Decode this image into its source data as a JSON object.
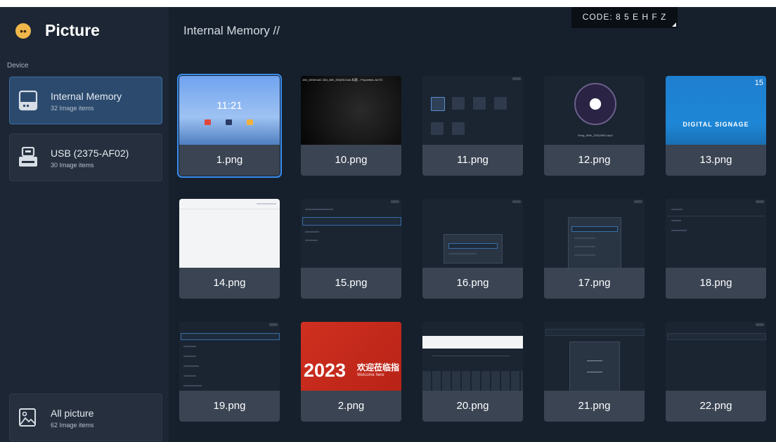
{
  "app": {
    "title": "Picture",
    "icon": "face-icon"
  },
  "sidebar": {
    "section_label": "Device",
    "devices": [
      {
        "name": "Internal Memory",
        "count": "32 Image items",
        "icon": "drive-icon",
        "active": true
      },
      {
        "name": "USB (2375-AF02)",
        "count": "30 Image items",
        "icon": "usb-drive-icon",
        "active": false
      }
    ],
    "all": {
      "name": "All picture",
      "count": "62 Image items",
      "icon": "gallery-icon"
    }
  },
  "header": {
    "breadcrumb": "Internal Memory //",
    "code": "CODE: 8 5 E H F Z"
  },
  "thumb_text": {
    "clock": "11:21",
    "digital_signage": "DIGITAL SIGNAGE",
    "year": "2023",
    "welcome_cn": "欢迎莅临指",
    "welcome_en": "Welcome here",
    "ds_time": "15",
    "song_caption": "Song_WAV_320(0000).mp3",
    "video_caption": "150_100M AAC 384_48K_SW(HD.Dub-标题...   Properties: AUTO"
  },
  "files": [
    {
      "name": "1.png",
      "selected": true
    },
    {
      "name": "10.png"
    },
    {
      "name": "11.png"
    },
    {
      "name": "12.png"
    },
    {
      "name": "13.png"
    },
    {
      "name": "14.png"
    },
    {
      "name": "15.png"
    },
    {
      "name": "16.png"
    },
    {
      "name": "17.png"
    },
    {
      "name": "18.png"
    },
    {
      "name": "19.png"
    },
    {
      "name": "2.png"
    },
    {
      "name": "20.png"
    },
    {
      "name": "21.png"
    },
    {
      "name": "22.png"
    }
  ],
  "colors": {
    "background": "#16202c",
    "sidebar": "#1c2634",
    "selected_device": "#2b4a6e",
    "accent": "#3a8ef0",
    "tile_label": "#3a4453",
    "red_banner": "#c7281b",
    "signage_blue": "#1e86d6"
  }
}
